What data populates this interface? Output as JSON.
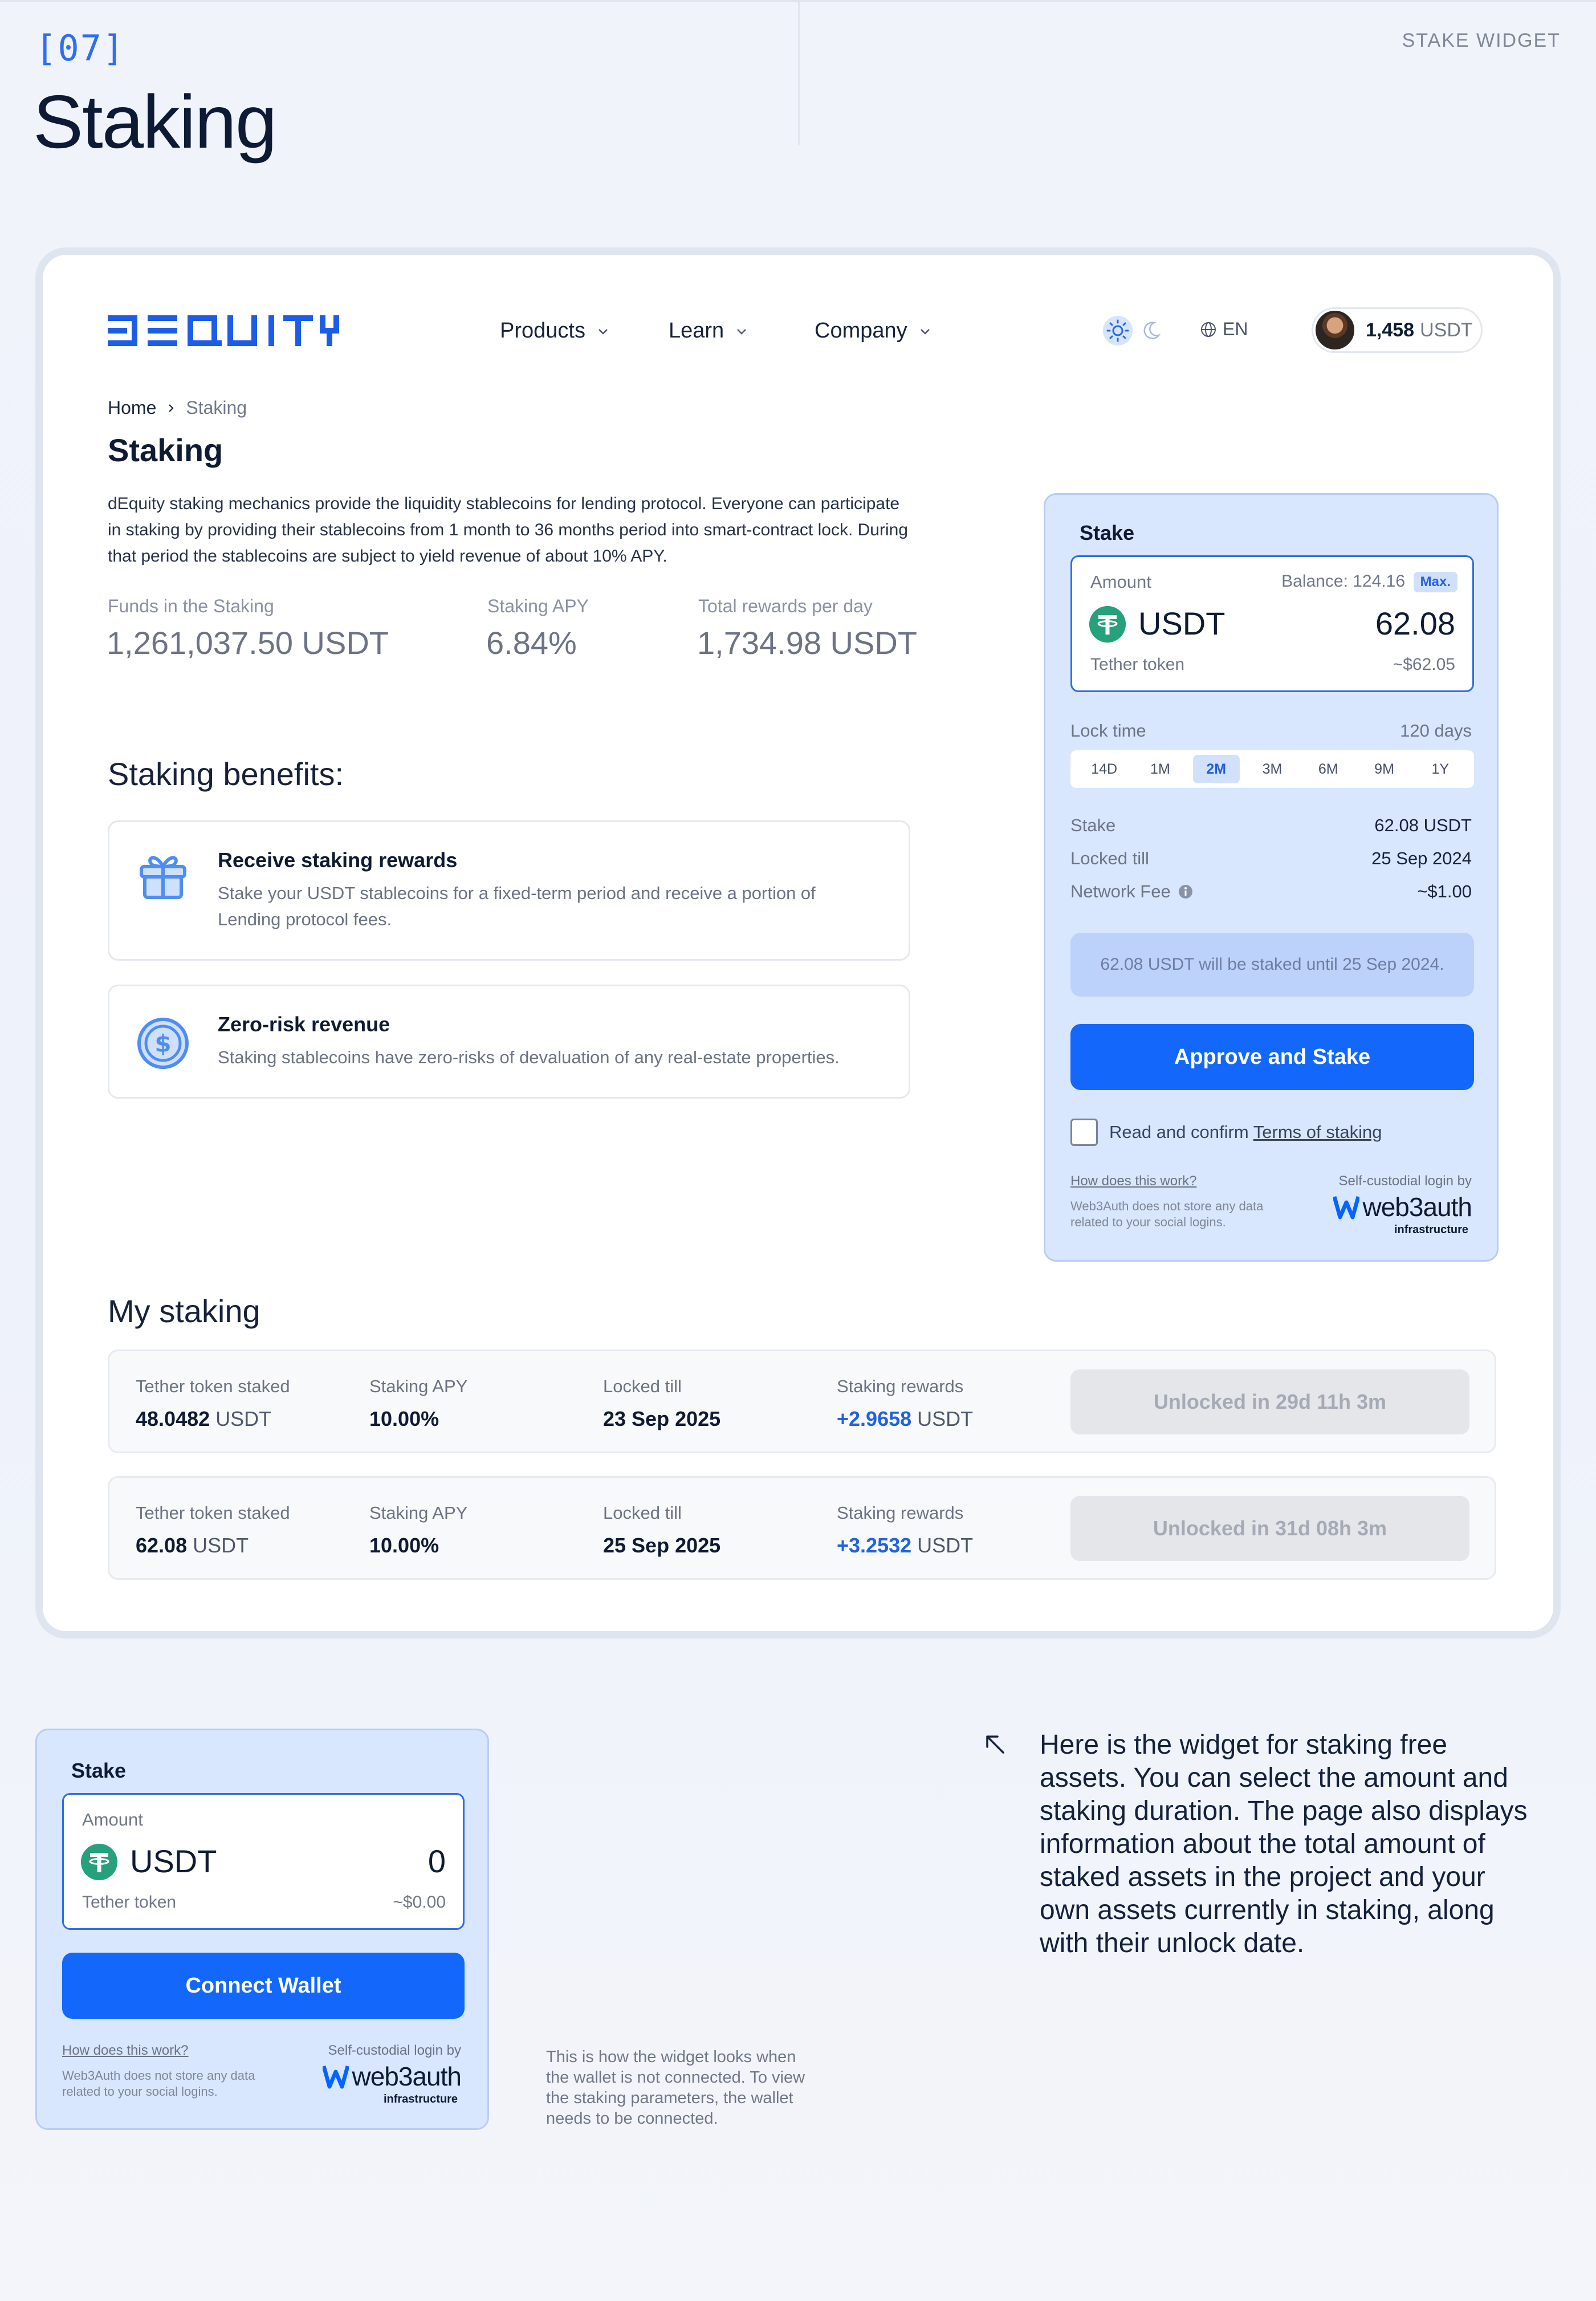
{
  "section": {
    "number": "[07]",
    "title": "Staking",
    "tag": "STAKE WIDGET"
  },
  "header": {
    "logo_text": "DEQUITY",
    "nav": [
      {
        "label": "Products"
      },
      {
        "label": "Learn"
      },
      {
        "label": "Company"
      }
    ],
    "language": "EN",
    "wallet": {
      "amount": "1,458",
      "currency": "USDT"
    }
  },
  "breadcrumb": {
    "home": "Home",
    "current": "Staking"
  },
  "page": {
    "title": "Staking",
    "intro": "dEquity staking mechanics provide the liquidity stablecoins for lending protocol. Everyone can participate in staking by providing their stablecoins from 1 month to 36 months period into smart-contract lock. During that period the stablecoins are subject to yield revenue of about 10% APY.",
    "stats": [
      {
        "label": "Funds in the Staking",
        "value": "1,261,037.50 USDT"
      },
      {
        "label": "Staking APY",
        "value": "6.84%"
      },
      {
        "label": "Total rewards per day",
        "value": "1,734.98 USDT"
      }
    ],
    "benefits_title": "Staking benefits:",
    "benefits": [
      {
        "icon": "gift-icon",
        "title": "Receive staking rewards",
        "desc": "Stake your USDT stablecoins for a fixed-term period and receive a portion of Lending protocol fees."
      },
      {
        "icon": "dollar-coin-icon",
        "title": "Zero-risk revenue",
        "desc": "Staking stablecoins have zero-risks of devaluation of any real-estate properties."
      }
    ]
  },
  "stake_widget": {
    "title": "Stake",
    "amount_label": "Amount",
    "balance": "Balance: 124.16",
    "max_label": "Max.",
    "token": "USDT",
    "amount": "62.08",
    "token_name": "Tether token",
    "usd_value": "~$62.05",
    "lock_label": "Lock time",
    "lock_days": "120 days",
    "lock_options": [
      "14D",
      "1M",
      "2M",
      "3M",
      "6M",
      "9M",
      "1Y"
    ],
    "lock_selected": "2M",
    "details": [
      {
        "label": "Stake",
        "value": "62.08 USDT"
      },
      {
        "label": "Locked till",
        "value": "25 Sep 2024"
      },
      {
        "label": "Network Fee",
        "value": "~$1.00"
      }
    ],
    "notice": "62.08 USDT will be staked until 25 Sep 2024.",
    "button": "Approve and Stake",
    "confirm_prefix": "Read and confirm ",
    "confirm_link": "Terms of staking",
    "how_link": "How does this work?",
    "how_desc_1": "Web3Auth does not store any data",
    "how_desc_2": "related to your social logins.",
    "login_by": "Self-custodial login by",
    "web3auth": "web3auth",
    "web3auth_sub": "infrastructure"
  },
  "my_staking": {
    "title": "My staking",
    "columns": [
      "Tether token staked",
      "Staking APY",
      "Locked till",
      "Staking rewards"
    ],
    "rows": [
      {
        "staked": "48.0482",
        "staked_unit": "USDT",
        "apy": "10.00%",
        "locked": "23 Sep 2025",
        "rewards": "+2.9658",
        "rewards_unit": "USDT",
        "status": "Unlocked in 29d 11h 3m"
      },
      {
        "staked": "62.08",
        "staked_unit": "USDT",
        "apy": "10.00%",
        "locked": "25 Sep 2025",
        "rewards": "+3.2532",
        "rewards_unit": "USDT",
        "status": "Unlocked in 31d 08h 3m"
      }
    ]
  },
  "disconnected_widget": {
    "title": "Stake",
    "amount_label": "Amount",
    "token": "USDT",
    "amount": "0",
    "token_name": "Tether token",
    "usd_value": "~$0.00",
    "button": "Connect Wallet",
    "how_link": "How does this work?",
    "how_desc_1": "Web3Auth does not store any data",
    "how_desc_2": "related to your social logins.",
    "login_by": "Self-custodial login by",
    "web3auth": "web3auth",
    "web3auth_sub": "infrastructure",
    "caption_lines": [
      "This is how the widget looks when",
      "the wallet is not connected. To view",
      "the staking parameters, the wallet",
      "needs to be connected."
    ]
  },
  "description": "Here is the widget for staking free assets. You can select the amount and staking duration. The page also displays information about the total amount of staked assets in the project and your own assets currently in staking, along with their unlock date.",
  "colors": {
    "accent": "#1368fb",
    "widget_bg": "#d8e6fe",
    "tether": "#26a17b",
    "reward_blue": "#2062e0"
  }
}
